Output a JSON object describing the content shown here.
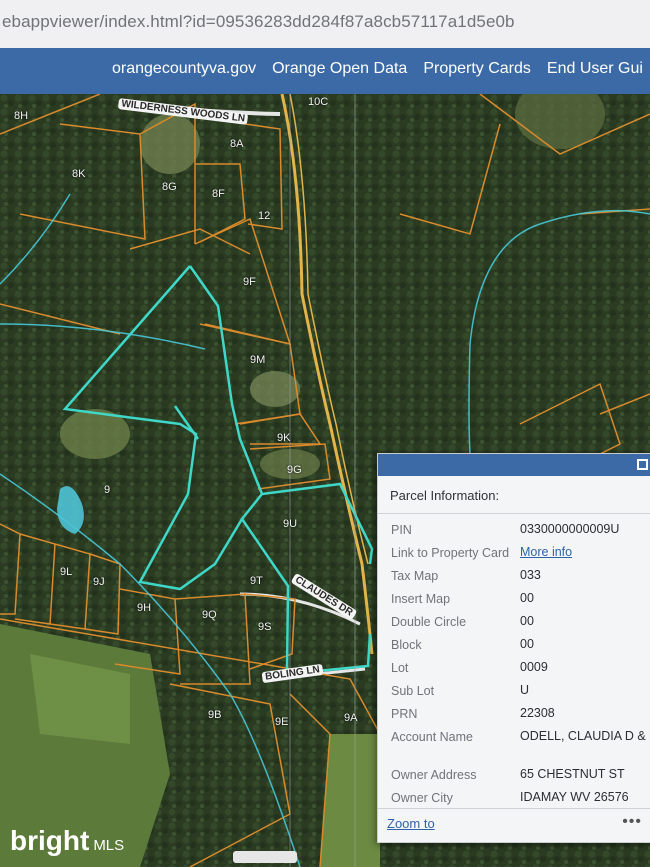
{
  "browser": {
    "url": "ebappviewer/index.html?id=09536283dd284f87a8cb57117a1d5e0b"
  },
  "nav": {
    "links": [
      "orangecountyva.gov",
      "Orange Open Data",
      "Property Cards",
      "End User Gui"
    ]
  },
  "map": {
    "parcel_labels": [
      "8H",
      "10C",
      "8A",
      "8K",
      "8G",
      "8F",
      "12",
      "9F",
      "9M",
      "9K",
      "9G",
      "9",
      "9U",
      "9L",
      "9J",
      "9T",
      "9H",
      "9Q",
      "9S",
      "9B",
      "9E",
      "9A"
    ],
    "road_labels": [
      "WILDERNESS WOODS LN",
      "CLAUDES DR",
      "BOLING LN"
    ],
    "colors": {
      "parcel_outline": "#d98a2c",
      "selected_outline": "#3fd8c8",
      "road": "#e2b449",
      "forest": "#2c3f24"
    }
  },
  "popup": {
    "title": "Parcel Information:",
    "fields": [
      {
        "label": "PIN",
        "value": "0330000000009U"
      },
      {
        "label": "Link to Property Card",
        "value": "More info"
      },
      {
        "label": "Tax Map",
        "value": "033"
      },
      {
        "label": "Insert Map",
        "value": "00"
      },
      {
        "label": "Double Circle",
        "value": "00"
      },
      {
        "label": "Block",
        "value": "00"
      },
      {
        "label": "Lot",
        "value": "0009"
      },
      {
        "label": "Sub Lot",
        "value": "U"
      },
      {
        "label": "PRN",
        "value": "22308"
      },
      {
        "label": "Account Name",
        "value": "ODELL, CLAUDIA D &"
      },
      {
        "label": "Owner Address",
        "value": "65 CHESTNUT ST"
      },
      {
        "label": "Owner City",
        "value": "IDAMAY WV 26576"
      }
    ],
    "zoom_label": "Zoom to",
    "more_label": "•••"
  },
  "watermark": {
    "brand": "bright",
    "suffix": "MLS"
  }
}
